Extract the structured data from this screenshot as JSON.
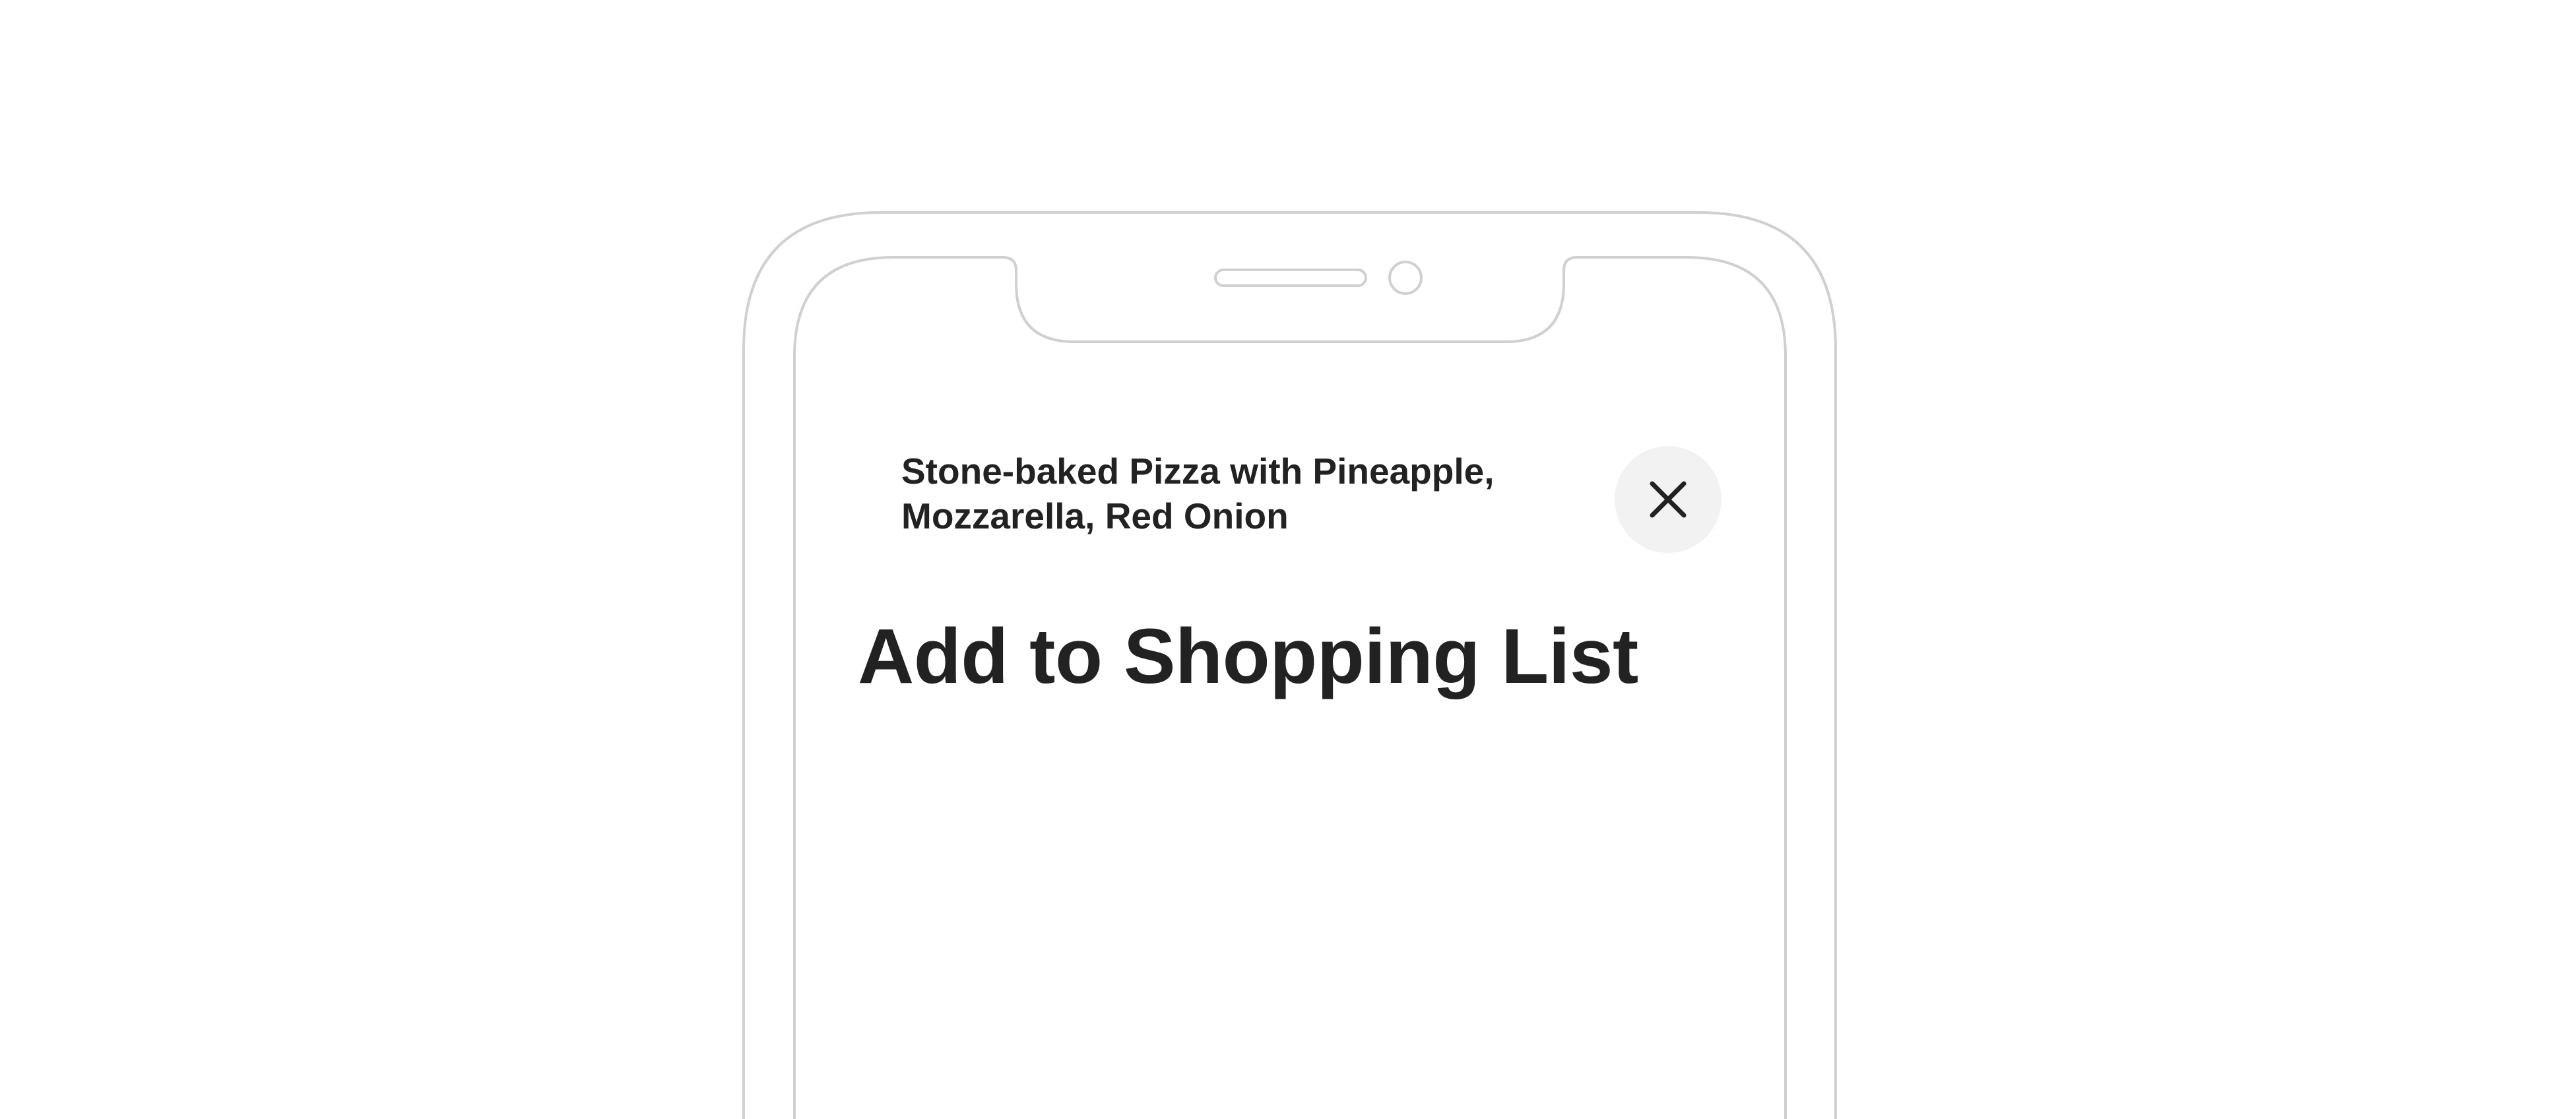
{
  "sheet": {
    "recipe_title": "Stone-baked Pizza with Pineapple, Mozzarella, Red Onion",
    "heading": "Add to Shopping List",
    "close_icon": "close-icon"
  },
  "colors": {
    "text": "#222222",
    "close_button_bg": "#f2f2f2",
    "device_outline": "#d0d0d0",
    "background": "#ffffff"
  }
}
